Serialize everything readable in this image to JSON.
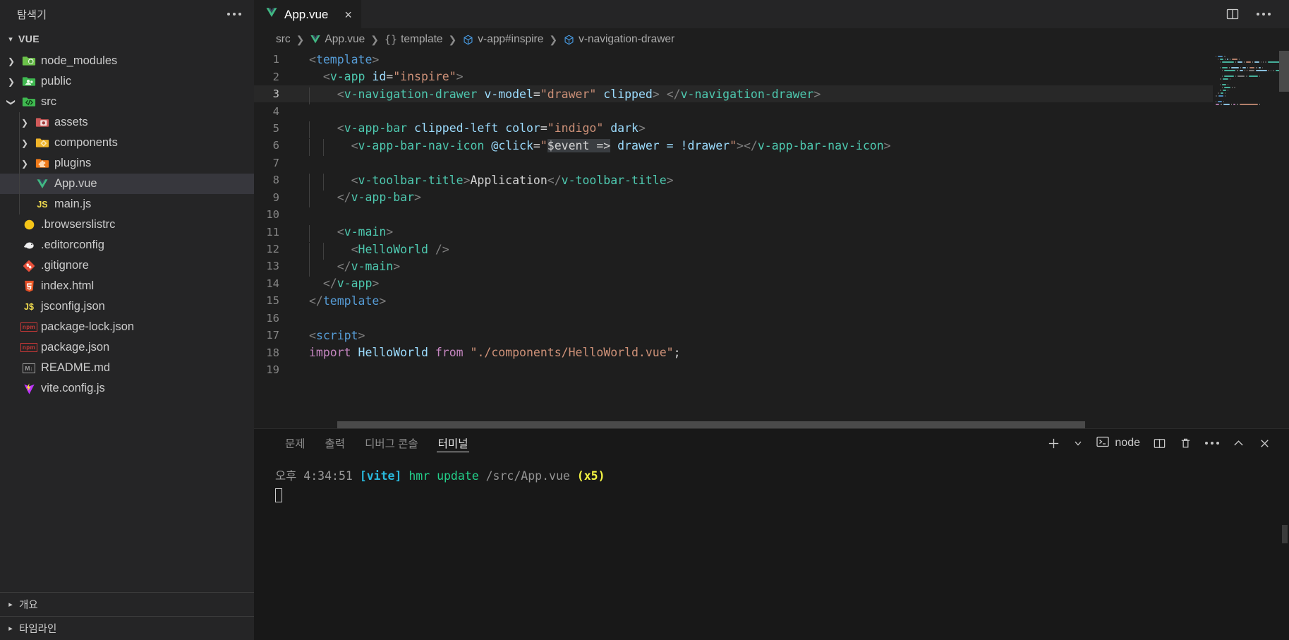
{
  "sidebar": {
    "title": "탐색기",
    "more_label": "추가 작업",
    "section": {
      "label": "VUE",
      "chevron": "chevron-down"
    },
    "items": [
      {
        "name": "node_modules",
        "type": "folder",
        "indent": 1,
        "chevron": "right",
        "icon": "nodejs-folder-icon",
        "icon_color": "#8cc84b",
        "active": false
      },
      {
        "name": "public",
        "type": "folder",
        "indent": 1,
        "chevron": "right",
        "icon": "public-folder-icon",
        "icon_color": "#3fb950",
        "active": false
      },
      {
        "name": "src",
        "type": "folder",
        "indent": 1,
        "chevron": "down",
        "icon": "src-folder-icon",
        "icon_color": "#3fb950",
        "active": false
      },
      {
        "name": "assets",
        "type": "folder",
        "indent": 2,
        "chevron": "right",
        "icon": "assets-folder-icon",
        "icon_color": "#d05a5a",
        "active": false
      },
      {
        "name": "components",
        "type": "folder",
        "indent": 2,
        "chevron": "right",
        "icon": "components-folder-icon",
        "icon_color": "#f0b429",
        "active": false
      },
      {
        "name": "plugins",
        "type": "folder",
        "indent": 2,
        "chevron": "right",
        "icon": "plugins-folder-icon",
        "icon_color": "#ef7a1a",
        "active": false
      },
      {
        "name": "App.vue",
        "type": "file",
        "indent": 2,
        "chevron": "",
        "icon": "vue-file-icon",
        "icon_color": "#41b883",
        "active": true
      },
      {
        "name": "main.js",
        "type": "file",
        "indent": 2,
        "chevron": "",
        "icon": "js-file-icon",
        "icon_color": "#f0db4f",
        "active": false
      },
      {
        "name": ".browserslistrc",
        "type": "file",
        "indent": 1,
        "chevron": "",
        "icon": "browserslist-icon",
        "icon_color": "#f5c518",
        "active": false
      },
      {
        "name": ".editorconfig",
        "type": "file",
        "indent": 1,
        "chevron": "",
        "icon": "editorconfig-icon",
        "icon_color": "#e8e8e8",
        "active": false
      },
      {
        "name": ".gitignore",
        "type": "file",
        "indent": 1,
        "chevron": "",
        "icon": "git-icon",
        "icon_color": "#e8503a",
        "active": false
      },
      {
        "name": "index.html",
        "type": "file",
        "indent": 1,
        "chevron": "",
        "icon": "html5-icon",
        "icon_color": "#e44d26",
        "active": false
      },
      {
        "name": "jsconfig.json",
        "type": "file",
        "indent": 1,
        "chevron": "",
        "icon": "jsconfig-icon",
        "icon_color": "#f0db4f",
        "active": false
      },
      {
        "name": "package-lock.json",
        "type": "file",
        "indent": 1,
        "chevron": "",
        "icon": "npm-icon",
        "icon_color": "#cb3837",
        "active": false
      },
      {
        "name": "package.json",
        "type": "file",
        "indent": 1,
        "chevron": "",
        "icon": "npm-icon",
        "icon_color": "#cb3837",
        "active": false
      },
      {
        "name": "README.md",
        "type": "file",
        "indent": 1,
        "chevron": "",
        "icon": "markdown-icon",
        "icon_color": "#9b9b9b",
        "active": false
      },
      {
        "name": "vite.config.js",
        "type": "file",
        "indent": 1,
        "chevron": "",
        "icon": "vite-icon",
        "icon_color": "#bd34fe",
        "active": false
      }
    ],
    "bottom_sections": [
      {
        "label": "개요"
      },
      {
        "label": "타임라인"
      }
    ]
  },
  "tab": {
    "label": "App.vue",
    "icon": "vue-file-icon",
    "close_label": "×",
    "split_editor_label": "편집기 분할",
    "more_actions_label": "추가 작업"
  },
  "breadcrumb": [
    {
      "text": "src",
      "icon": ""
    },
    {
      "text": "App.vue",
      "icon": "vue-file-icon"
    },
    {
      "text": "template",
      "icon": "braces-icon"
    },
    {
      "text": "v-app#inspire",
      "icon": "cube-icon"
    },
    {
      "text": "v-navigation-drawer",
      "icon": "cube-icon"
    }
  ],
  "editor": {
    "current_line": 3,
    "lines": [
      {
        "n": 1,
        "indent": 0,
        "tokens": [
          {
            "t": "<",
            "c": "punc"
          },
          {
            "t": "template",
            "c": "tag"
          },
          {
            "t": ">",
            "c": "punc"
          }
        ]
      },
      {
        "n": 2,
        "indent": 1,
        "tokens": [
          {
            "t": "<",
            "c": "punc"
          },
          {
            "t": "v-app",
            "c": "comp"
          },
          {
            "t": " ",
            "c": "plain"
          },
          {
            "t": "id",
            "c": "attr"
          },
          {
            "t": "=",
            "c": "plain"
          },
          {
            "t": "\"inspire\"",
            "c": "str"
          },
          {
            "t": ">",
            "c": "punc"
          }
        ]
      },
      {
        "n": 3,
        "indent": 2,
        "tokens": [
          {
            "t": "<",
            "c": "punc"
          },
          {
            "t": "v-navigation-drawer",
            "c": "comp"
          },
          {
            "t": " ",
            "c": "plain"
          },
          {
            "t": "v-model",
            "c": "attr"
          },
          {
            "t": "=",
            "c": "plain"
          },
          {
            "t": "\"drawer\"",
            "c": "str"
          },
          {
            "t": " ",
            "c": "plain"
          },
          {
            "t": "clipped",
            "c": "attr"
          },
          {
            "t": ">",
            "c": "punc"
          },
          {
            "t": " ",
            "c": "plain"
          },
          {
            "t": "</",
            "c": "punc"
          },
          {
            "t": "v-navigation-drawer",
            "c": "comp"
          },
          {
            "t": ">",
            "c": "punc"
          }
        ]
      },
      {
        "n": 4,
        "indent": 0,
        "tokens": []
      },
      {
        "n": 5,
        "indent": 2,
        "tokens": [
          {
            "t": "<",
            "c": "punc"
          },
          {
            "t": "v-app-bar",
            "c": "comp"
          },
          {
            "t": " ",
            "c": "plain"
          },
          {
            "t": "clipped-left",
            "c": "attr"
          },
          {
            "t": " ",
            "c": "plain"
          },
          {
            "t": "color",
            "c": "attr"
          },
          {
            "t": "=",
            "c": "plain"
          },
          {
            "t": "\"indigo\"",
            "c": "str"
          },
          {
            "t": " ",
            "c": "plain"
          },
          {
            "t": "dark",
            "c": "attr"
          },
          {
            "t": ">",
            "c": "punc"
          }
        ]
      },
      {
        "n": 6,
        "indent": 3,
        "tokens": [
          {
            "t": "<",
            "c": "punc"
          },
          {
            "t": "v-app-bar-nav-icon",
            "c": "comp"
          },
          {
            "t": " ",
            "c": "plain"
          },
          {
            "t": "@click",
            "c": "attr"
          },
          {
            "t": "=",
            "c": "plain"
          },
          {
            "t": "\"",
            "c": "str"
          },
          {
            "t": "$event =>",
            "c": "plain sel"
          },
          {
            "t": " drawer = !drawer",
            "c": "attr"
          },
          {
            "t": "\"",
            "c": "str"
          },
          {
            "t": ">",
            "c": "punc"
          },
          {
            "t": "</",
            "c": "punc"
          },
          {
            "t": "v-app-bar-nav-icon",
            "c": "comp"
          },
          {
            "t": ">",
            "c": "punc"
          }
        ]
      },
      {
        "n": 7,
        "indent": 0,
        "tokens": []
      },
      {
        "n": 8,
        "indent": 3,
        "tokens": [
          {
            "t": "<",
            "c": "punc"
          },
          {
            "t": "v-toolbar-title",
            "c": "comp"
          },
          {
            "t": ">",
            "c": "punc"
          },
          {
            "t": "Application",
            "c": "plain"
          },
          {
            "t": "</",
            "c": "punc"
          },
          {
            "t": "v-toolbar-title",
            "c": "comp"
          },
          {
            "t": ">",
            "c": "punc"
          }
        ]
      },
      {
        "n": 9,
        "indent": 2,
        "tokens": [
          {
            "t": "</",
            "c": "punc"
          },
          {
            "t": "v-app-bar",
            "c": "comp"
          },
          {
            "t": ">",
            "c": "punc"
          }
        ]
      },
      {
        "n": 10,
        "indent": 0,
        "tokens": []
      },
      {
        "n": 11,
        "indent": 2,
        "tokens": [
          {
            "t": "<",
            "c": "punc"
          },
          {
            "t": "v-main",
            "c": "comp"
          },
          {
            "t": ">",
            "c": "punc"
          }
        ]
      },
      {
        "n": 12,
        "indent": 3,
        "tokens": [
          {
            "t": "<",
            "c": "punc"
          },
          {
            "t": "HelloWorld",
            "c": "comp"
          },
          {
            "t": " ",
            "c": "plain"
          },
          {
            "t": "/>",
            "c": "punc"
          }
        ]
      },
      {
        "n": 13,
        "indent": 2,
        "tokens": [
          {
            "t": "</",
            "c": "punc"
          },
          {
            "t": "v-main",
            "c": "comp"
          },
          {
            "t": ">",
            "c": "punc"
          }
        ]
      },
      {
        "n": 14,
        "indent": 1,
        "tokens": [
          {
            "t": "</",
            "c": "punc"
          },
          {
            "t": "v-app",
            "c": "comp"
          },
          {
            "t": ">",
            "c": "punc"
          }
        ]
      },
      {
        "n": 15,
        "indent": 0,
        "tokens": [
          {
            "t": "</",
            "c": "punc"
          },
          {
            "t": "template",
            "c": "tag"
          },
          {
            "t": ">",
            "c": "punc"
          }
        ]
      },
      {
        "n": 16,
        "indent": 0,
        "tokens": []
      },
      {
        "n": 17,
        "indent": 0,
        "tokens": [
          {
            "t": "<",
            "c": "punc"
          },
          {
            "t": "script",
            "c": "tag"
          },
          {
            "t": ">",
            "c": "punc"
          }
        ]
      },
      {
        "n": 18,
        "indent": 0,
        "tokens": [
          {
            "t": "import",
            "c": "kw"
          },
          {
            "t": " ",
            "c": "plain"
          },
          {
            "t": "HelloWorld",
            "c": "attr"
          },
          {
            "t": " ",
            "c": "plain"
          },
          {
            "t": "from",
            "c": "kw"
          },
          {
            "t": " ",
            "c": "plain"
          },
          {
            "t": "\"./components/HelloWorld.vue\"",
            "c": "str"
          },
          {
            "t": ";",
            "c": "plain"
          }
        ]
      },
      {
        "n": 19,
        "indent": 0,
        "tokens": []
      }
    ]
  },
  "panel": {
    "tabs": [
      {
        "label": "문제",
        "active": false
      },
      {
        "label": "출력",
        "active": false
      },
      {
        "label": "디버그 콘솔",
        "active": false
      },
      {
        "label": "터미널",
        "active": true
      }
    ],
    "actions": {
      "new_terminal": "+",
      "new_terminal_dropdown": "chevron-down",
      "shell_label": "node",
      "shell_icon": "terminal-icon",
      "split_label": "터미널 분할",
      "kill_label": "터미널 종료",
      "views_label": "보기 및 추가 작업",
      "maximize_label": "패널 크기 최대화",
      "close_label": "패널 닫기"
    },
    "terminal_output": [
      {
        "segments": [
          {
            "t": "오후",
            "c": "t-dim"
          },
          {
            "t": " 4:34:51 ",
            "c": "t-dim"
          },
          {
            "t": "[vite]",
            "c": "t-cyan"
          },
          {
            "t": " ",
            "c": "t-dim"
          },
          {
            "t": "hmr update",
            "c": "t-green"
          },
          {
            "t": " ",
            "c": "t-dim"
          },
          {
            "t": "/src/App.vue",
            "c": "t-gray"
          },
          {
            "t": " ",
            "c": "t-dim"
          },
          {
            "t": "(x5)",
            "c": "t-yellow"
          }
        ]
      }
    ]
  },
  "colors": {
    "sidebar_bg": "#252526",
    "editor_bg": "#1e1e1e",
    "panel_bg": "#181818",
    "active_row": "#37373d",
    "accent": "#41b883",
    "selection": "#3a3d41"
  }
}
